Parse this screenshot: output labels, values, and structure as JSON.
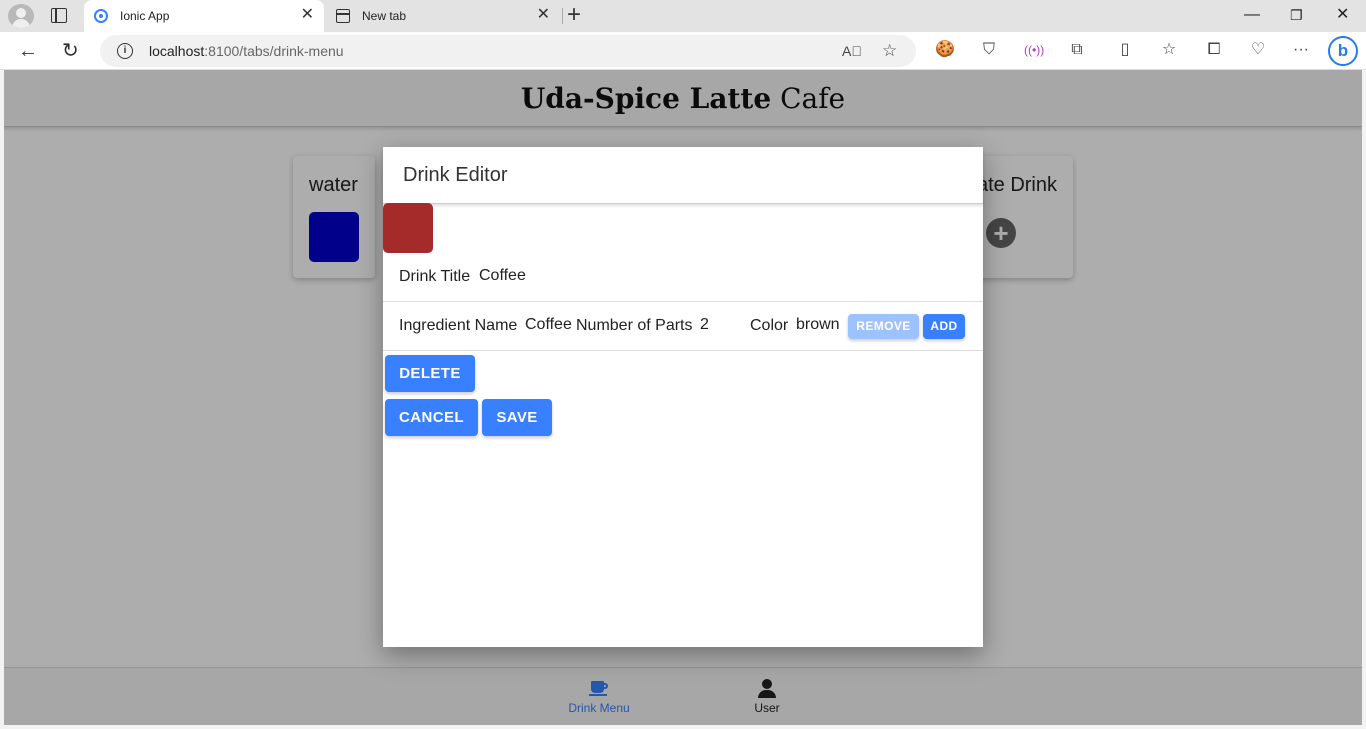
{
  "browser": {
    "tabs": [
      {
        "title": "Ionic App",
        "active": true
      },
      {
        "title": "New tab",
        "active": false
      }
    ],
    "address": {
      "host": "localhost",
      "path": ":8100/tabs/drink-menu"
    }
  },
  "app": {
    "title_bold": "Uda-Spice Latte",
    "title_light": "Cafe",
    "cards": {
      "water": {
        "title": "water",
        "color": "#0000cc"
      },
      "create": {
        "title": "Create Drink"
      }
    },
    "tabs": [
      {
        "label": "Drink Menu",
        "icon": "cafe-icon",
        "selected": true
      },
      {
        "label": "User",
        "icon": "person-icon",
        "selected": false
      }
    ]
  },
  "modal": {
    "title": "Drink Editor",
    "drink_color": "#a52a2a",
    "drink_title_label": "Drink Title",
    "drink_title_value": "Coffee",
    "ingredient": {
      "name_label": "Ingredient Name",
      "name_value": "Coffee",
      "parts_label": "Number of Parts",
      "parts_value": "2",
      "color_label": "Color",
      "color_value": "brown"
    },
    "buttons": {
      "remove": "Remove",
      "add": "Add",
      "delete": "Delete",
      "cancel": "Cancel",
      "save": "Save"
    }
  }
}
